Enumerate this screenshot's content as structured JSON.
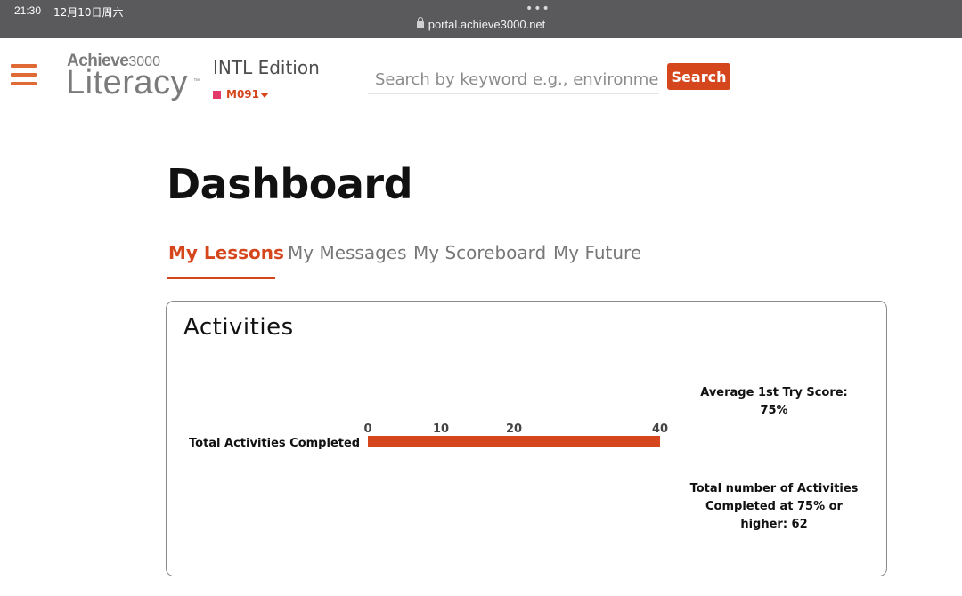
{
  "status_bar": {
    "time": "21:30",
    "date": "12月10日周六",
    "dots": "•••",
    "url": "portal.achieve3000.net"
  },
  "header": {
    "logo_top": "Achieve",
    "logo_num": "3000",
    "logo_bottom": "Literacy",
    "logo_tm": "™",
    "edition": "INTL Edition",
    "class_code": "M091",
    "search_placeholder": "Search by keyword e.g., environment",
    "search_button": "Search"
  },
  "page": {
    "title": "Dashboard",
    "tabs": [
      {
        "label": "My Lessons",
        "active": true
      },
      {
        "label": "My Messages",
        "active": false
      },
      {
        "label": "My Scoreboard",
        "active": false
      },
      {
        "label": "My Future",
        "active": false
      }
    ]
  },
  "activities": {
    "title": "Activities",
    "bar_label": "Total Activities Completed",
    "average_label": "Average 1st Try Score:",
    "average_value": "75%",
    "total_line1": "Total number of Activities",
    "total_line2": "Completed at 75% or",
    "total_line3": "higher: 62"
  },
  "chart_data": {
    "type": "bar",
    "categories": [
      "Total Activities Completed"
    ],
    "values": [
      40
    ],
    "ticks": [
      0,
      10,
      20,
      40
    ],
    "xlim": [
      0,
      40
    ],
    "orientation": "horizontal",
    "bar_color": "#d6461c"
  },
  "colors": {
    "accent": "#d6461c",
    "hamburger": "#e06a35",
    "class_marker": "#e23a6b"
  }
}
